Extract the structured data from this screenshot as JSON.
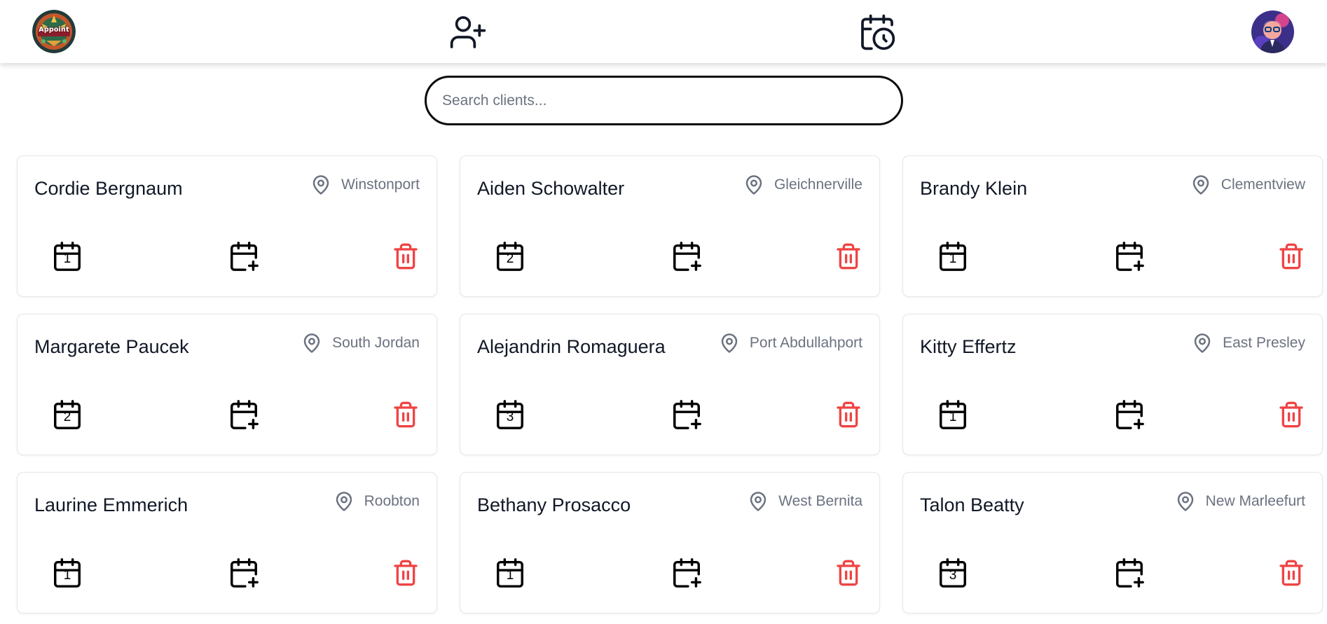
{
  "app": {
    "logo_text": "Appoint"
  },
  "nav": {
    "add_client_icon": "user-plus-icon",
    "schedule_icon": "calendar-clock-icon",
    "avatar_icon": "user-avatar"
  },
  "search": {
    "placeholder": "Search clients...",
    "value": ""
  },
  "colors": {
    "delete": "#ef4444",
    "muted_text": "#6b7280",
    "card_border": "#e5e7eb"
  },
  "clients": [
    {
      "name": "Cordie Bergnaum",
      "city": "Winstonport",
      "appointments": "1"
    },
    {
      "name": "Aiden Schowalter",
      "city": "Gleichnerville",
      "appointments": "2"
    },
    {
      "name": "Brandy Klein",
      "city": "Clementview",
      "appointments": "1"
    },
    {
      "name": "Margarete Paucek",
      "city": "South Jordan",
      "appointments": "2"
    },
    {
      "name": "Alejandrin Romaguera",
      "city": "Port Abdullahport",
      "appointments": "3"
    },
    {
      "name": "Kitty Effertz",
      "city": "East Presley",
      "appointments": "1"
    },
    {
      "name": "Laurine Emmerich",
      "city": "Roobton",
      "appointments": "1"
    },
    {
      "name": "Bethany Prosacco",
      "city": "West Bernita",
      "appointments": "1"
    },
    {
      "name": "Talon Beatty",
      "city": "New Marleefurt",
      "appointments": "3"
    }
  ]
}
